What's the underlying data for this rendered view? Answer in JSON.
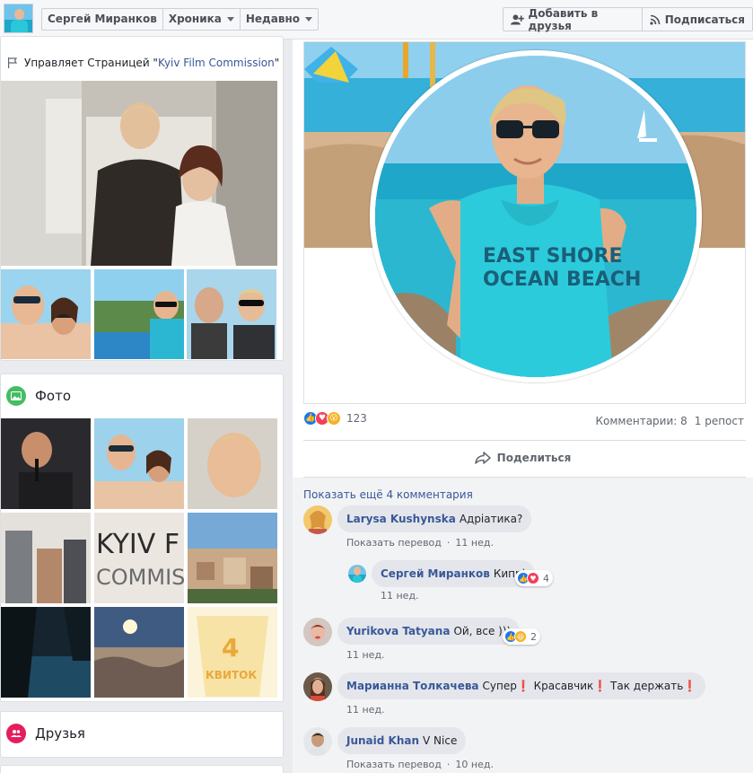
{
  "topbar": {
    "breadcrumbs": [
      "Сергей Миранков",
      "Хроника",
      "Недавно"
    ],
    "add_friend": "Добавить в друзья",
    "subscribe": "Подписаться"
  },
  "intro": {
    "manages_prefix": "Управляет Страницей \"",
    "manages_link": "Kyiv Film Commission",
    "manages_suffix": "\""
  },
  "photos": {
    "title": "Фото"
  },
  "friends": {
    "title": "Друзья"
  },
  "post": {
    "reaction_count": "123",
    "comments_count": "Комментарии: 8",
    "reposts_count": "1 репост",
    "share_label": "Поделиться",
    "cover_shirt_line1": "EAST SHORE",
    "cover_shirt_line2": "OCEAN BEACH"
  },
  "comments": {
    "show_more": "Показать ещё 4 комментария",
    "items": [
      {
        "name": "Larysa Kushynska",
        "text": "Адріатика?",
        "translate": "Показать перевод",
        "time": "11 нед."
      },
      {
        "name": "Сергей Миранков",
        "text": "Кипр)",
        "time": "11 нед.",
        "reactions": "4"
      },
      {
        "name": "Yurikova Tatyana",
        "text": "Ой, все )))",
        "time": "11 нед.",
        "reactions": "2"
      },
      {
        "name": "Марианна Толкачева",
        "text": "Супер❗ Красавчик❗ Так держать❗",
        "time": "11 нед."
      },
      {
        "name": "Junaid Khan",
        "text": "V Nice",
        "translate": "Показать перевод",
        "time": "10 нед."
      }
    ]
  },
  "colors": {
    "link": "#385898",
    "like": "#1877f2",
    "love": "#f33e58",
    "wow": "#f7b125",
    "photo_icon": "#45bd62",
    "friends_icon": "#e41e5d"
  }
}
